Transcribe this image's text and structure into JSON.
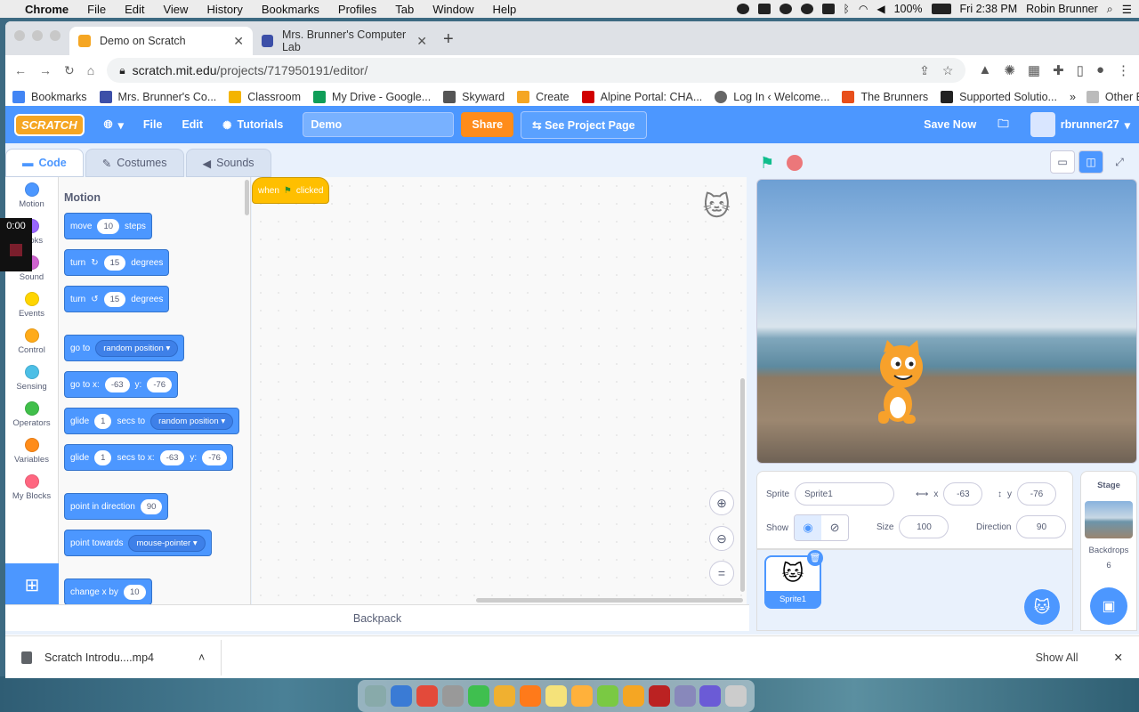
{
  "menubar": {
    "app": "Chrome",
    "items": [
      "File",
      "Edit",
      "View",
      "History",
      "Bookmarks",
      "Profiles",
      "Tab",
      "Window",
      "Help"
    ],
    "battery": "100%",
    "clock": "Fri 2:38 PM",
    "user": "Robin Brunner"
  },
  "tabs": [
    {
      "title": "Demo on Scratch",
      "color": "#f5a623"
    },
    {
      "title": "Mrs. Brunner's Computer Lab",
      "color": "#3c4fa8"
    }
  ],
  "address": {
    "domain": "scratch.mit.edu",
    "path": "/projects/717950191/editor/"
  },
  "bookmarks": [
    {
      "label": "Bookmarks",
      "color": "#4285f4"
    },
    {
      "label": "Mrs. Brunner's Co...",
      "color": "#3c4fa8"
    },
    {
      "label": "Classroom",
      "color": "#f4b400"
    },
    {
      "label": "My Drive - Google...",
      "color": "#0f9d58"
    },
    {
      "label": "Skyward",
      "color": "#555555"
    },
    {
      "label": "Create",
      "color": "#f5a623"
    },
    {
      "label": "Alpine Portal: CHA...",
      "color": "#d10000"
    },
    {
      "label": "Log In ‹ Welcome...",
      "color": "#666666"
    },
    {
      "label": "The Brunners",
      "color": "#e84f1b"
    },
    {
      "label": "Supported Solutio...",
      "color": "#222222"
    }
  ],
  "bookmarks_more": "»",
  "other_bookmarks": "Other Bookmarks",
  "scratch": {
    "logo": "SCRATCH",
    "menu": {
      "file": "File",
      "edit": "Edit",
      "tutorials": "Tutorials"
    },
    "project_title": "Demo",
    "share": "Share",
    "see_project": "See Project Page",
    "save_now": "Save Now",
    "username": "rbrunner27",
    "editor_tabs": [
      "Code",
      "Costumes",
      "Sounds"
    ],
    "categories": [
      {
        "label": "Motion",
        "color": "#4c97ff"
      },
      {
        "label": "Looks",
        "color": "#9966ff"
      },
      {
        "label": "Sound",
        "color": "#cf63cf"
      },
      {
        "label": "Events",
        "color": "#ffd500"
      },
      {
        "label": "Control",
        "color": "#ffab19"
      },
      {
        "label": "Sensing",
        "color": "#4cbfe6"
      },
      {
        "label": "Operators",
        "color": "#40bf4a"
      },
      {
        "label": "Variables",
        "color": "#ff8c1a"
      },
      {
        "label": "My Blocks",
        "color": "#ff6680"
      }
    ],
    "palette_title": "Motion",
    "blocks": {
      "move": {
        "label": "move",
        "value": "10",
        "suffix": "steps"
      },
      "turn_right": {
        "label": "turn",
        "value": "15",
        "suffix": "degrees"
      },
      "turn_left": {
        "label": "turn",
        "value": "15",
        "suffix": "degrees"
      },
      "go_to": {
        "label": "go to",
        "dropdown": "random position"
      },
      "go_to_xy": {
        "label": "go to x:",
        "x": "-63",
        "ylabel": "y:",
        "y": "-76"
      },
      "glide_random": {
        "label": "glide",
        "value": "1",
        "mid": "secs to",
        "dropdown": "random position"
      },
      "glide_xy": {
        "label": "glide",
        "value": "1",
        "mid": "secs to x:",
        "x": "-63",
        "ylabel": "y:",
        "y": "-76"
      },
      "point_dir": {
        "label": "point in direction",
        "value": "90"
      },
      "point_towards": {
        "label": "point towards",
        "dropdown": "mouse-pointer"
      },
      "change_x": {
        "label": "change x by",
        "value": "10"
      }
    },
    "hat_block": {
      "label_start": "when",
      "label_end": "clicked"
    },
    "backpack": "Backpack",
    "sprite_info": {
      "sprite_label": "Sprite",
      "sprite_name": "Sprite1",
      "x_label": "x",
      "x": "-63",
      "y_label": "y",
      "y": "-76",
      "show_label": "Show",
      "size_label": "Size",
      "size": "100",
      "direction_label": "Direction",
      "direction": "90"
    },
    "sprite_thumb": "Sprite1",
    "stage_panel": {
      "label": "Stage",
      "backdrops_label": "Backdrops",
      "backdrops_count": "6"
    }
  },
  "recorder_time": "0:00",
  "download": {
    "file": "Scratch Introdu....mp4",
    "show_all": "Show All"
  }
}
